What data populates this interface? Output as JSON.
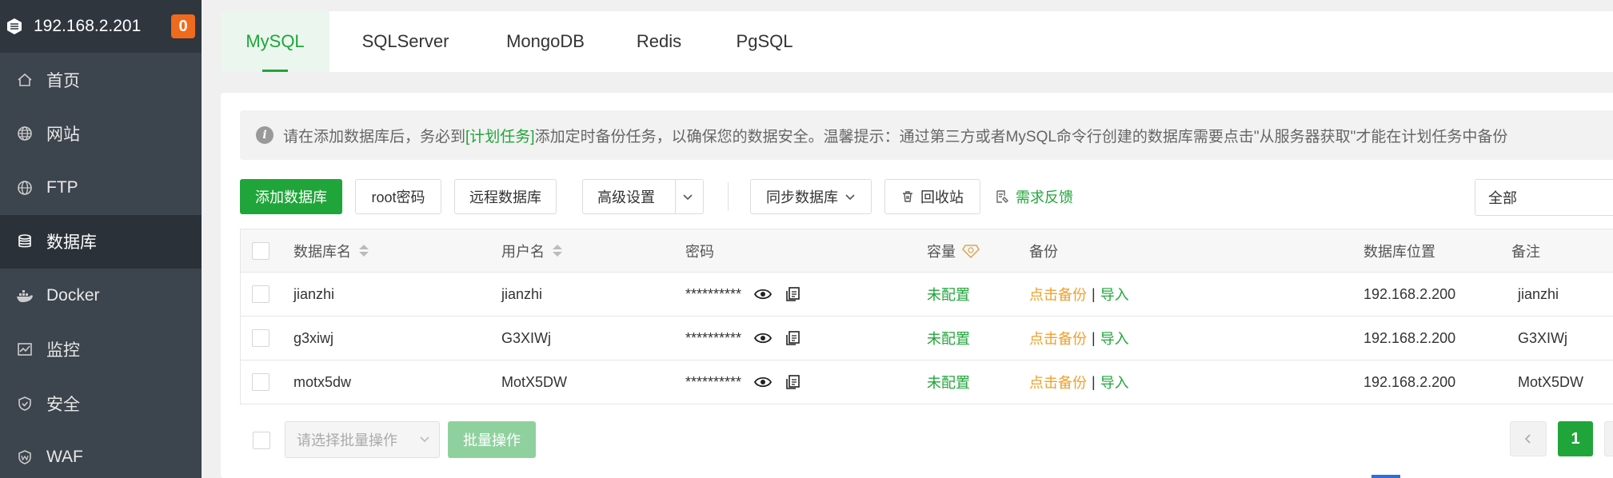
{
  "sidebar": {
    "server_ip": "192.168.2.201",
    "badge_count": "0",
    "items": [
      {
        "label": "首页",
        "icon": "home-icon"
      },
      {
        "label": "网站",
        "icon": "globe-icon"
      },
      {
        "label": "FTP",
        "icon": "ftp-globe-icon"
      },
      {
        "label": "数据库",
        "icon": "database-icon",
        "active": true
      },
      {
        "label": "Docker",
        "icon": "docker-icon"
      },
      {
        "label": "监控",
        "icon": "monitor-chart-icon"
      },
      {
        "label": "安全",
        "icon": "shield-icon"
      },
      {
        "label": "WAF",
        "icon": "waf-shield-icon"
      }
    ]
  },
  "tabs": [
    "MySQL",
    "SQLServer",
    "MongoDB",
    "Redis",
    "PgSQL"
  ],
  "active_tab": "MySQL",
  "notice": {
    "prefix": "请在添加数据库后，务必到",
    "link": "[计划任务]",
    "suffix": "添加定时备份任务，以确保您的数据安全。温馨提示：通过第三方或者MySQL命令行创建的数据库需要点击\"从服务器获取\"才能在计划任务中备份"
  },
  "toolbar": {
    "add_db": "添加数据库",
    "root_pwd": "root密码",
    "remote_db": "远程数据库",
    "advanced": "高级设置",
    "sync_db": "同步数据库",
    "recycle": "回收站",
    "feedback": "需求反馈",
    "filter_value": "全部"
  },
  "table": {
    "headers": {
      "name": "数据库名",
      "user": "用户名",
      "password": "密码",
      "capacity": "容量",
      "backup": "备份",
      "location": "数据库位置",
      "remark": "备注"
    },
    "rows": [
      {
        "name": "jianzhi",
        "user": "jianzhi",
        "password": "**********",
        "capacity": "未配置",
        "backup_action": "点击备份",
        "import_action": "导入",
        "location": "192.168.2.200",
        "remark": "jianzhi"
      },
      {
        "name": "g3xiwj",
        "user": "G3XIWj",
        "password": "**********",
        "capacity": "未配置",
        "backup_action": "点击备份",
        "import_action": "导入",
        "location": "192.168.2.200",
        "remark": "G3XIWj"
      },
      {
        "name": "motx5dw",
        "user": "MotX5DW",
        "password": "**********",
        "capacity": "未配置",
        "backup_action": "点击备份",
        "import_action": "导入",
        "location": "192.168.2.200",
        "remark": "MotX5DW"
      }
    ]
  },
  "footer": {
    "batch_placeholder": "请选择批量操作",
    "batch_button": "批量操作",
    "current_page": "1"
  },
  "colors": {
    "accent": "#20a53a",
    "sidebar_bg": "#3c444d",
    "badge": "#f06a1d",
    "backup_link": "#f0a02c"
  }
}
